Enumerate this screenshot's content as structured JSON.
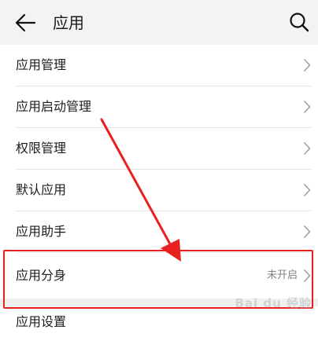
{
  "header": {
    "title": "应用",
    "back_icon": "arrow-left-icon",
    "search_icon": "search-icon"
  },
  "menu": {
    "items": [
      {
        "label": "应用管理"
      },
      {
        "label": "应用启动管理"
      },
      {
        "label": "权限管理"
      },
      {
        "label": "默认应用"
      },
      {
        "label": "应用助手"
      },
      {
        "label": "应用分身",
        "value": "未开启"
      }
    ],
    "next_section": {
      "label": "应用设置"
    }
  },
  "annotation": {
    "color": "#e8201f"
  },
  "watermark": {
    "text": "Bai du 经验"
  }
}
